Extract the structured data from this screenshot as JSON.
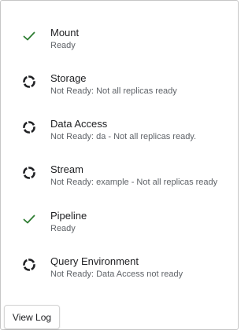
{
  "colors": {
    "check": "#2e7d32",
    "spinner": "#202124",
    "name_text": "#202124",
    "status_text": "#5f6368"
  },
  "components": [
    {
      "name": "Mount",
      "status": "Ready",
      "icon": "check-icon"
    },
    {
      "name": "Storage",
      "status": "Not Ready: Not all replicas ready",
      "icon": "loading-spinner-icon"
    },
    {
      "name": "Data Access",
      "status": "Not Ready: da - Not all replicas ready.",
      "icon": "loading-spinner-icon"
    },
    {
      "name": "Stream",
      "status": "Not Ready: example - Not all replicas ready",
      "icon": "loading-spinner-icon"
    },
    {
      "name": "Pipeline",
      "status": "Ready",
      "icon": "check-icon"
    },
    {
      "name": "Query Environment",
      "status": "Not Ready: Data Access not ready",
      "icon": "loading-spinner-icon"
    }
  ],
  "actions": {
    "view_log_label": "View Log"
  }
}
